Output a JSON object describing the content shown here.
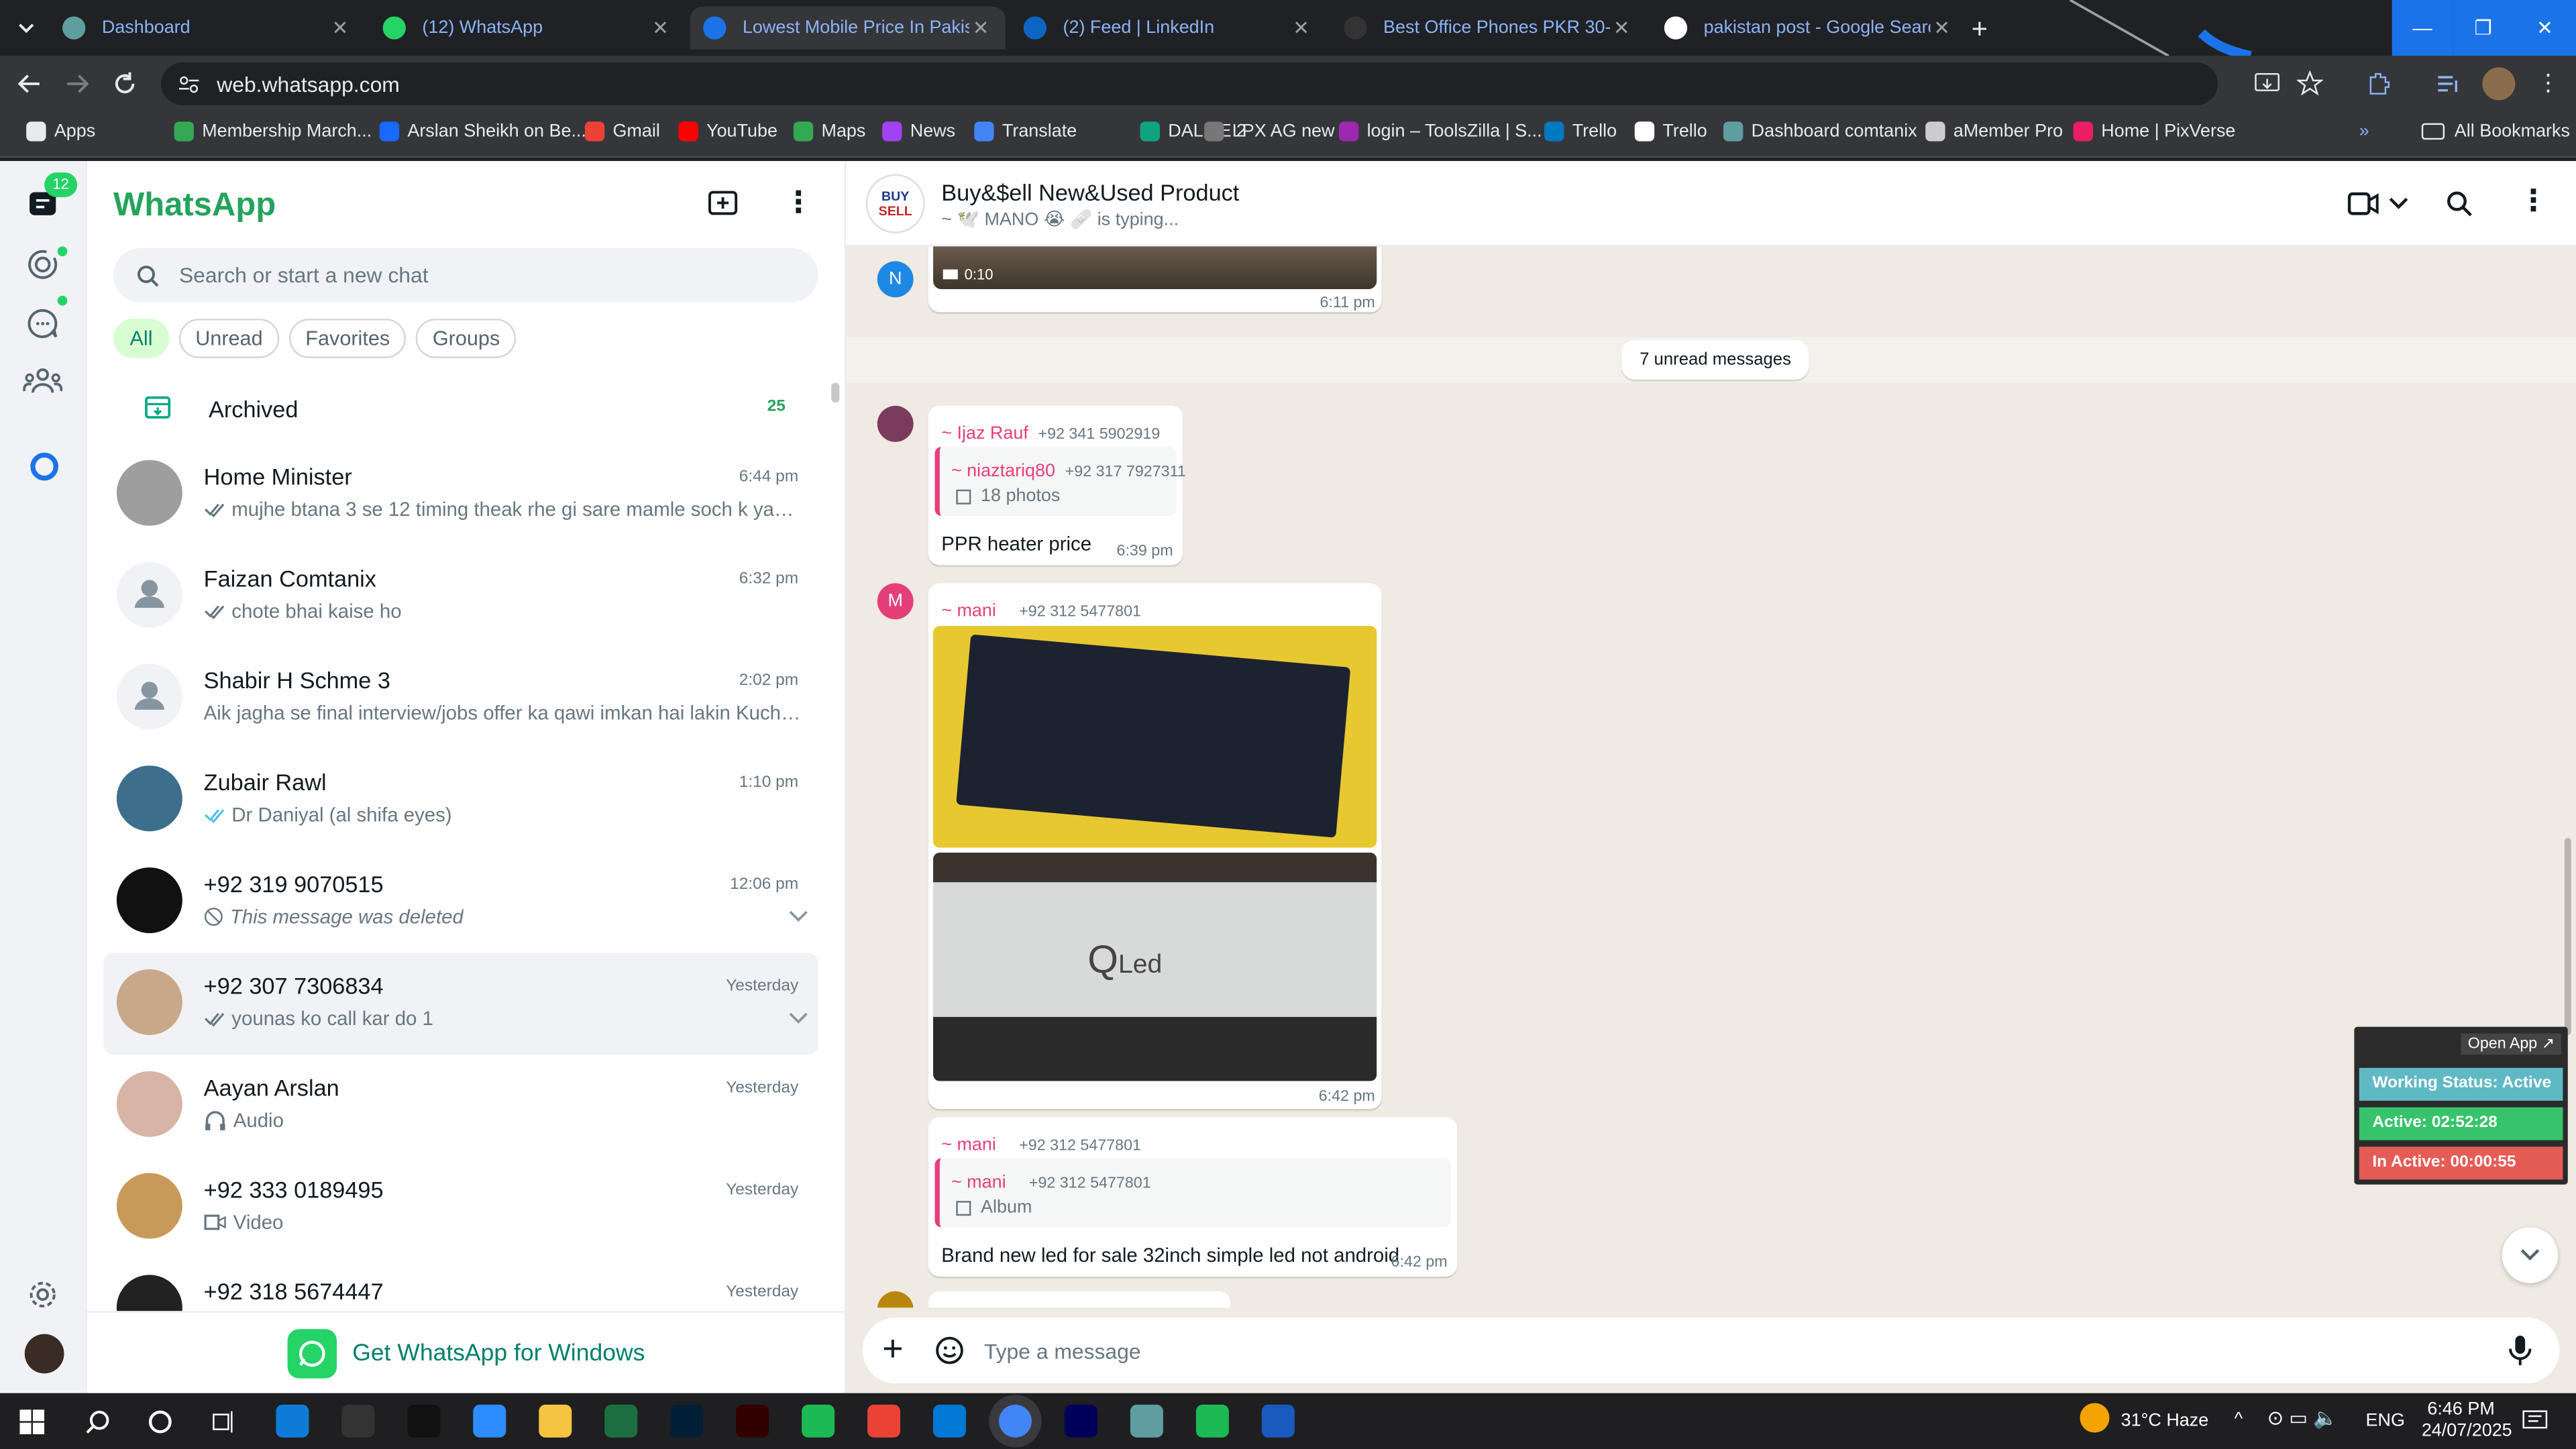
{
  "browser": {
    "tabs": [
      {
        "title": "Dashboard",
        "icon": "app-icon"
      },
      {
        "title": "(12) WhatsApp",
        "icon": "whatsapp-icon"
      },
      {
        "title": "Lowest Mobile Price In Pakistan",
        "icon": "shield-icon"
      },
      {
        "title": "(2) Feed | LinkedIn",
        "icon": "linkedin-icon"
      },
      {
        "title": "Best Office Phones PKR 30-35K",
        "icon": "chatgpt-icon"
      },
      {
        "title": "pakistan post - Google Search",
        "icon": "google-icon"
      }
    ],
    "address": "web.whatsapp.com",
    "bookmarks": [
      "Apps",
      "Membership March...",
      "Arslan Sheikh on Be...",
      "Gmail",
      "YouTube",
      "Maps",
      "News",
      "Translate",
      "DALL·E 2",
      "LPX AG new",
      "login – ToolsZilla | S...",
      "Trello",
      "Trello",
      "Dashboard comtanix",
      "aMember Pro",
      "Home | PixVerse"
    ],
    "all_bookmarks": "All Bookmarks"
  },
  "rail": {
    "unread_badge": "12"
  },
  "sidebar": {
    "title": "WhatsApp",
    "search_placeholder": "Search or start a new chat",
    "filters": [
      "All",
      "Unread",
      "Favorites",
      "Groups"
    ],
    "archived_label": "Archived",
    "archived_count": "25",
    "chats": [
      {
        "name": "Home Minister",
        "time": "6:44 pm",
        "preview": "mujhe btana 3 se 12 timing theak rhe gi sare mamle soch k yani 2...",
        "icon": "double-check-icon",
        "avatar": "#9e9e9e"
      },
      {
        "name": "Faizan Comtanix",
        "time": "6:32 pm",
        "preview": "chote bhai kaise ho",
        "icon": "double-check-icon",
        "avatar": "default"
      },
      {
        "name": "Shabir H  Schme 3",
        "time": "2:02 pm",
        "preview": "Aik jagha se final interview/jobs offer ka qawi imkan hai lakin Kuch d...",
        "icon": "",
        "avatar": "default"
      },
      {
        "name": "Zubair Rawl",
        "time": "1:10 pm",
        "preview": "Dr Daniyal (al shifa eyes)",
        "icon": "double-check-blue-icon",
        "avatar": "#3d6e8c"
      },
      {
        "name": "+92 319 9070515",
        "time": "12:06 pm",
        "preview": "This message was deleted",
        "icon": "deleted-icon",
        "avatar": "#111111"
      },
      {
        "name": "+92 307 7306834",
        "time": "Yesterday",
        "preview": "younas ko call kar do 1",
        "icon": "double-check-icon",
        "avatar": "#c9a88a"
      },
      {
        "name": "Aayan Arslan",
        "time": "Yesterday",
        "preview": "Audio",
        "icon": "headphones-icon",
        "avatar": "#d8b4a6"
      },
      {
        "name": "+92 333 0189495",
        "time": "Yesterday",
        "preview": "Video",
        "icon": "video-icon",
        "avatar": "#c89a5a"
      },
      {
        "name": "+92 318 5674447",
        "time": "Yesterday",
        "preview": "",
        "icon": "",
        "avatar": "#222222"
      }
    ],
    "promo": "Get WhatsApp for Windows"
  },
  "chat": {
    "group_name": "Buy&$ell New&Used Product",
    "status": "~ 🕊️ MANO 😭 🩹 is typing...",
    "video_duration": "0:10",
    "video_time": "6:11 pm",
    "unread_banner": "7 unread messages",
    "msg1": {
      "sender": "~ Ijaz Rauf",
      "phone": "+92 341 5902919",
      "quote_sender": "~ niaztariq80",
      "quote_phone": "+92 317 7927311",
      "quote_text": "18 photos",
      "text": "PPR heater price",
      "time": "6:39 pm"
    },
    "msg2": {
      "sender": "~ mani",
      "phone": "+92 312 5477801",
      "time": "6:42 pm",
      "avatar_letter": "M"
    },
    "msg3": {
      "sender": "~ mani",
      "phone": "+92 312 5477801",
      "quote_sender": "~ mani",
      "quote_phone": "+92 312 5477801",
      "quote_text": "Album",
      "text": "Brand new led for sale 32inch simple led not android",
      "time": "6:42 pm"
    },
    "prev_avatar_letter": "N",
    "input_placeholder": "Type a message"
  },
  "status_panel": {
    "open_app": "Open App ↗",
    "working": "Working Status: Active",
    "active": "Active: 02:52:28",
    "inactive": "In Active: 00:00:55"
  },
  "taskbar": {
    "weather": "31°C  Haze",
    "lang": "ENG",
    "time": "6:46 PM",
    "date": "24/07/2025"
  }
}
